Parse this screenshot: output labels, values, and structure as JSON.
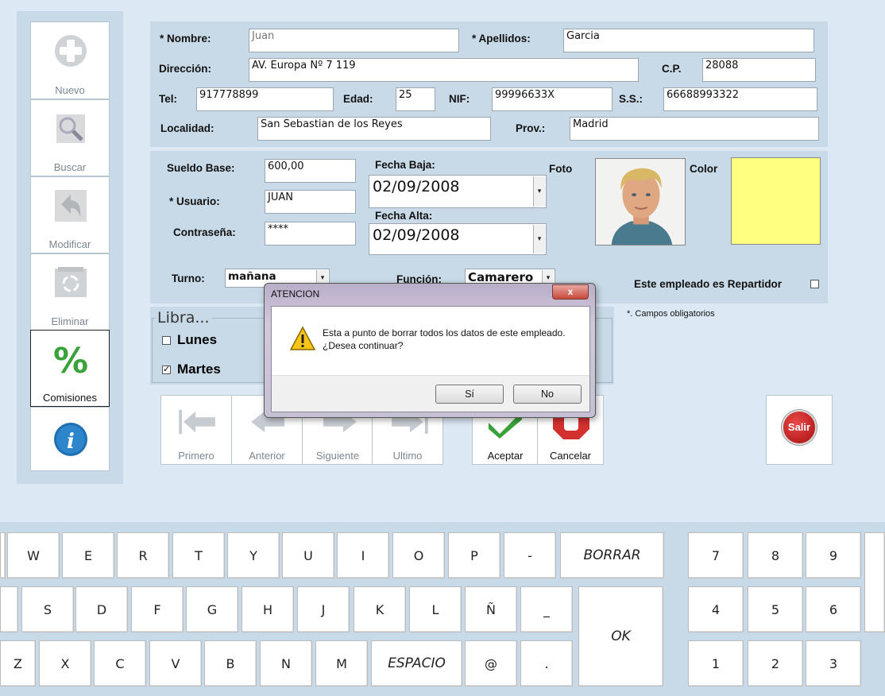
{
  "toolbar": {
    "items": [
      {
        "label": "Nuevo"
      },
      {
        "label": "Buscar"
      },
      {
        "label": "Modificar"
      },
      {
        "label": "Eliminar"
      },
      {
        "label": "Comisiones"
      }
    ]
  },
  "form": {
    "nombre_label": "* Nombre:",
    "nombre_value": "Juan",
    "apellidos_label": "* Apellidos:",
    "apellidos_value": "Garcia",
    "direccion_label": "Dirección:",
    "direccion_value": "AV. Europa Nº 7 119",
    "cp_label": "C.P.",
    "cp_value": "28088",
    "tel_label": "Tel:",
    "tel_value": "917778899",
    "edad_label": "Edad:",
    "edad_value": "25",
    "nif_label": "NIF:",
    "nif_value": "99996633X",
    "ss_label": "S.S.:",
    "ss_value": "66688993322",
    "localidad_label": "Localidad:",
    "localidad_value": "San Sebastian de los Reyes",
    "prov_label": "Prov.:",
    "prov_value": "Madrid",
    "sueldo_label": "Sueldo Base:",
    "sueldo_value": "600,00",
    "usuario_label": "* Usuario:",
    "usuario_value": "JUAN",
    "contrasena_label": "Contraseña:",
    "contrasena_value": "****",
    "fecha_baja_label": "Fecha Baja:",
    "fecha_baja_value": "02/09/2008",
    "fecha_alta_label": "Fecha Alta:",
    "fecha_alta_value": "02/09/2008",
    "foto_label": "Foto",
    "color_label": "Color",
    "color_value": "#ffff80",
    "turno_label": "Turno:",
    "turno_value": "mañana",
    "funcion_label": "Función:",
    "funcion_value": "Camarero",
    "repartidor_label": "Este empleado es Repartidor",
    "repartidor_checked": false,
    "obligatorios_note": "*. Campos obligatorios"
  },
  "libranza": {
    "title": "Libra...",
    "days": [
      {
        "label": "Lunes",
        "checked": false,
        "mark": ""
      },
      {
        "label": "Martes",
        "checked": true,
        "mark": "✓"
      }
    ]
  },
  "nav": {
    "primero": "Primero",
    "anterior": "Anterior",
    "siguiente": "Siguiente",
    "ultimo": "Ultimo",
    "aceptar": "Aceptar",
    "cancelar": "Cancelar",
    "salir": "Salir"
  },
  "dialog": {
    "title": "ATENCION",
    "message_line1": "Esta a punto de borrar todos los datos de este empleado.",
    "message_line2": "¿Desea continuar?",
    "yes": "Sí",
    "no": "No",
    "close": "x"
  },
  "keyboard": {
    "row1": [
      "W",
      "E",
      "R",
      "T",
      "Y",
      "U",
      "I",
      "O",
      "P",
      "-"
    ],
    "borrar": "BORRAR",
    "row2": [
      "S",
      "D",
      "F",
      "G",
      "H",
      "J",
      "K",
      "L",
      "Ñ",
      "_"
    ],
    "ok": "OK",
    "row3": [
      "Z",
      "X",
      "C",
      "V",
      "B",
      "N",
      "M"
    ],
    "espacio": "ESPACIO",
    "row3_tail": [
      "@",
      "."
    ],
    "numpad": [
      "7",
      "8",
      "9",
      "4",
      "5",
      "6",
      "1",
      "2",
      "3"
    ]
  }
}
